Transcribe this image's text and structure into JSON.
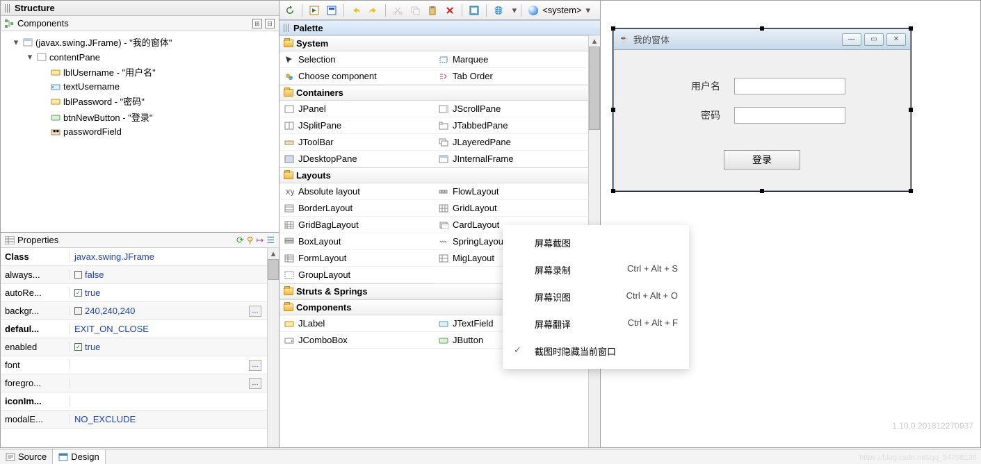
{
  "structure": {
    "title": "Structure"
  },
  "components": {
    "title": "Components",
    "tree": [
      {
        "label": "(javax.swing.JFrame) - \"我的窗体\"",
        "indent": 1,
        "twisty": "▾",
        "icon": "frame"
      },
      {
        "label": "contentPane",
        "indent": 2,
        "twisty": "▾",
        "icon": "panel"
      },
      {
        "label": "lblUsername - \"用户名\"",
        "indent": 3,
        "icon": "label"
      },
      {
        "label": "textUsername",
        "indent": 3,
        "icon": "text"
      },
      {
        "label": "lblPassword - \"密码\"",
        "indent": 3,
        "icon": "label"
      },
      {
        "label": "btnNewButton - \"登录\"",
        "indent": 3,
        "icon": "button"
      },
      {
        "label": "passwordField",
        "indent": 3,
        "icon": "password"
      }
    ]
  },
  "properties": {
    "title": "Properties",
    "rows": [
      {
        "k": "Class",
        "v": "javax.swing.JFrame",
        "bold": true
      },
      {
        "k": "always...",
        "v": "false",
        "chk": false
      },
      {
        "k": "autoRe...",
        "v": "true",
        "chk": true
      },
      {
        "k": "backgr...",
        "v": "240,240,240",
        "swatch": true,
        "dots": true
      },
      {
        "k": "defaul...",
        "v": "EXIT_ON_CLOSE",
        "bold": true
      },
      {
        "k": "enabled",
        "v": "true",
        "chk": true
      },
      {
        "k": "font",
        "v": "",
        "dots": true
      },
      {
        "k": "foregro...",
        "v": "",
        "dots": true
      },
      {
        "k": "iconIm...",
        "v": "",
        "bold": true
      },
      {
        "k": "modalE...",
        "v": "NO_EXCLUDE"
      }
    ]
  },
  "toolbar": {
    "system_label": "<system>"
  },
  "palette": {
    "title": "Palette",
    "cats": [
      {
        "name": "System",
        "items": [
          [
            "Selection",
            "cursor"
          ],
          [
            "Marquee",
            "marquee"
          ],
          [
            "Choose component",
            "choose"
          ],
          [
            "Tab Order",
            "taborder"
          ]
        ]
      },
      {
        "name": "Containers",
        "items": [
          [
            "JPanel",
            "panel"
          ],
          [
            "JScrollPane",
            "scroll"
          ],
          [
            "JSplitPane",
            "split"
          ],
          [
            "JTabbedPane",
            "tabbed"
          ],
          [
            "JToolBar",
            "toolbar"
          ],
          [
            "JLayeredPane",
            "layered"
          ],
          [
            "JDesktopPane",
            "desktop"
          ],
          [
            "JInternalFrame",
            "iframe"
          ]
        ]
      },
      {
        "name": "Layouts",
        "items": [
          [
            "Absolute layout",
            "abs"
          ],
          [
            "FlowLayout",
            "flow"
          ],
          [
            "BorderLayout",
            "border"
          ],
          [
            "GridLayout",
            "grid"
          ],
          [
            "GridBagLayout",
            "gridbag"
          ],
          [
            "CardLayout",
            "card"
          ],
          [
            "BoxLayout",
            "box"
          ],
          [
            "SpringLayout",
            "spring"
          ],
          [
            "FormLayout",
            "form"
          ],
          [
            "MigLayout",
            "mig"
          ],
          [
            "GroupLayout",
            "group"
          ]
        ]
      },
      {
        "name": "Struts & Springs",
        "items": []
      },
      {
        "name": "Components",
        "items": [
          [
            "JLabel",
            "label"
          ],
          [
            "JTextField",
            "text"
          ],
          [
            "JComboBox",
            "combo"
          ],
          [
            "JButton",
            "button"
          ]
        ]
      }
    ]
  },
  "frame": {
    "title": "我的窗体",
    "username_label": "用户名",
    "password_label": "密码",
    "login_label": "登录"
  },
  "ctx": {
    "items": [
      {
        "t": "屏幕截图",
        "sc": ""
      },
      {
        "t": "屏幕录制",
        "sc": "Ctrl + Alt + S"
      },
      {
        "t": "屏幕识图",
        "sc": "Ctrl + Alt + O"
      },
      {
        "t": "屏幕翻译",
        "sc": "Ctrl + Alt + F"
      },
      {
        "t": "截图时隐藏当前窗口",
        "sc": "",
        "chk": true
      }
    ]
  },
  "tabs": {
    "source": "Source",
    "design": "Design"
  },
  "version": "1.10.0.201812270937",
  "watermark": "https://blog.csdn.net/qq_54798136"
}
